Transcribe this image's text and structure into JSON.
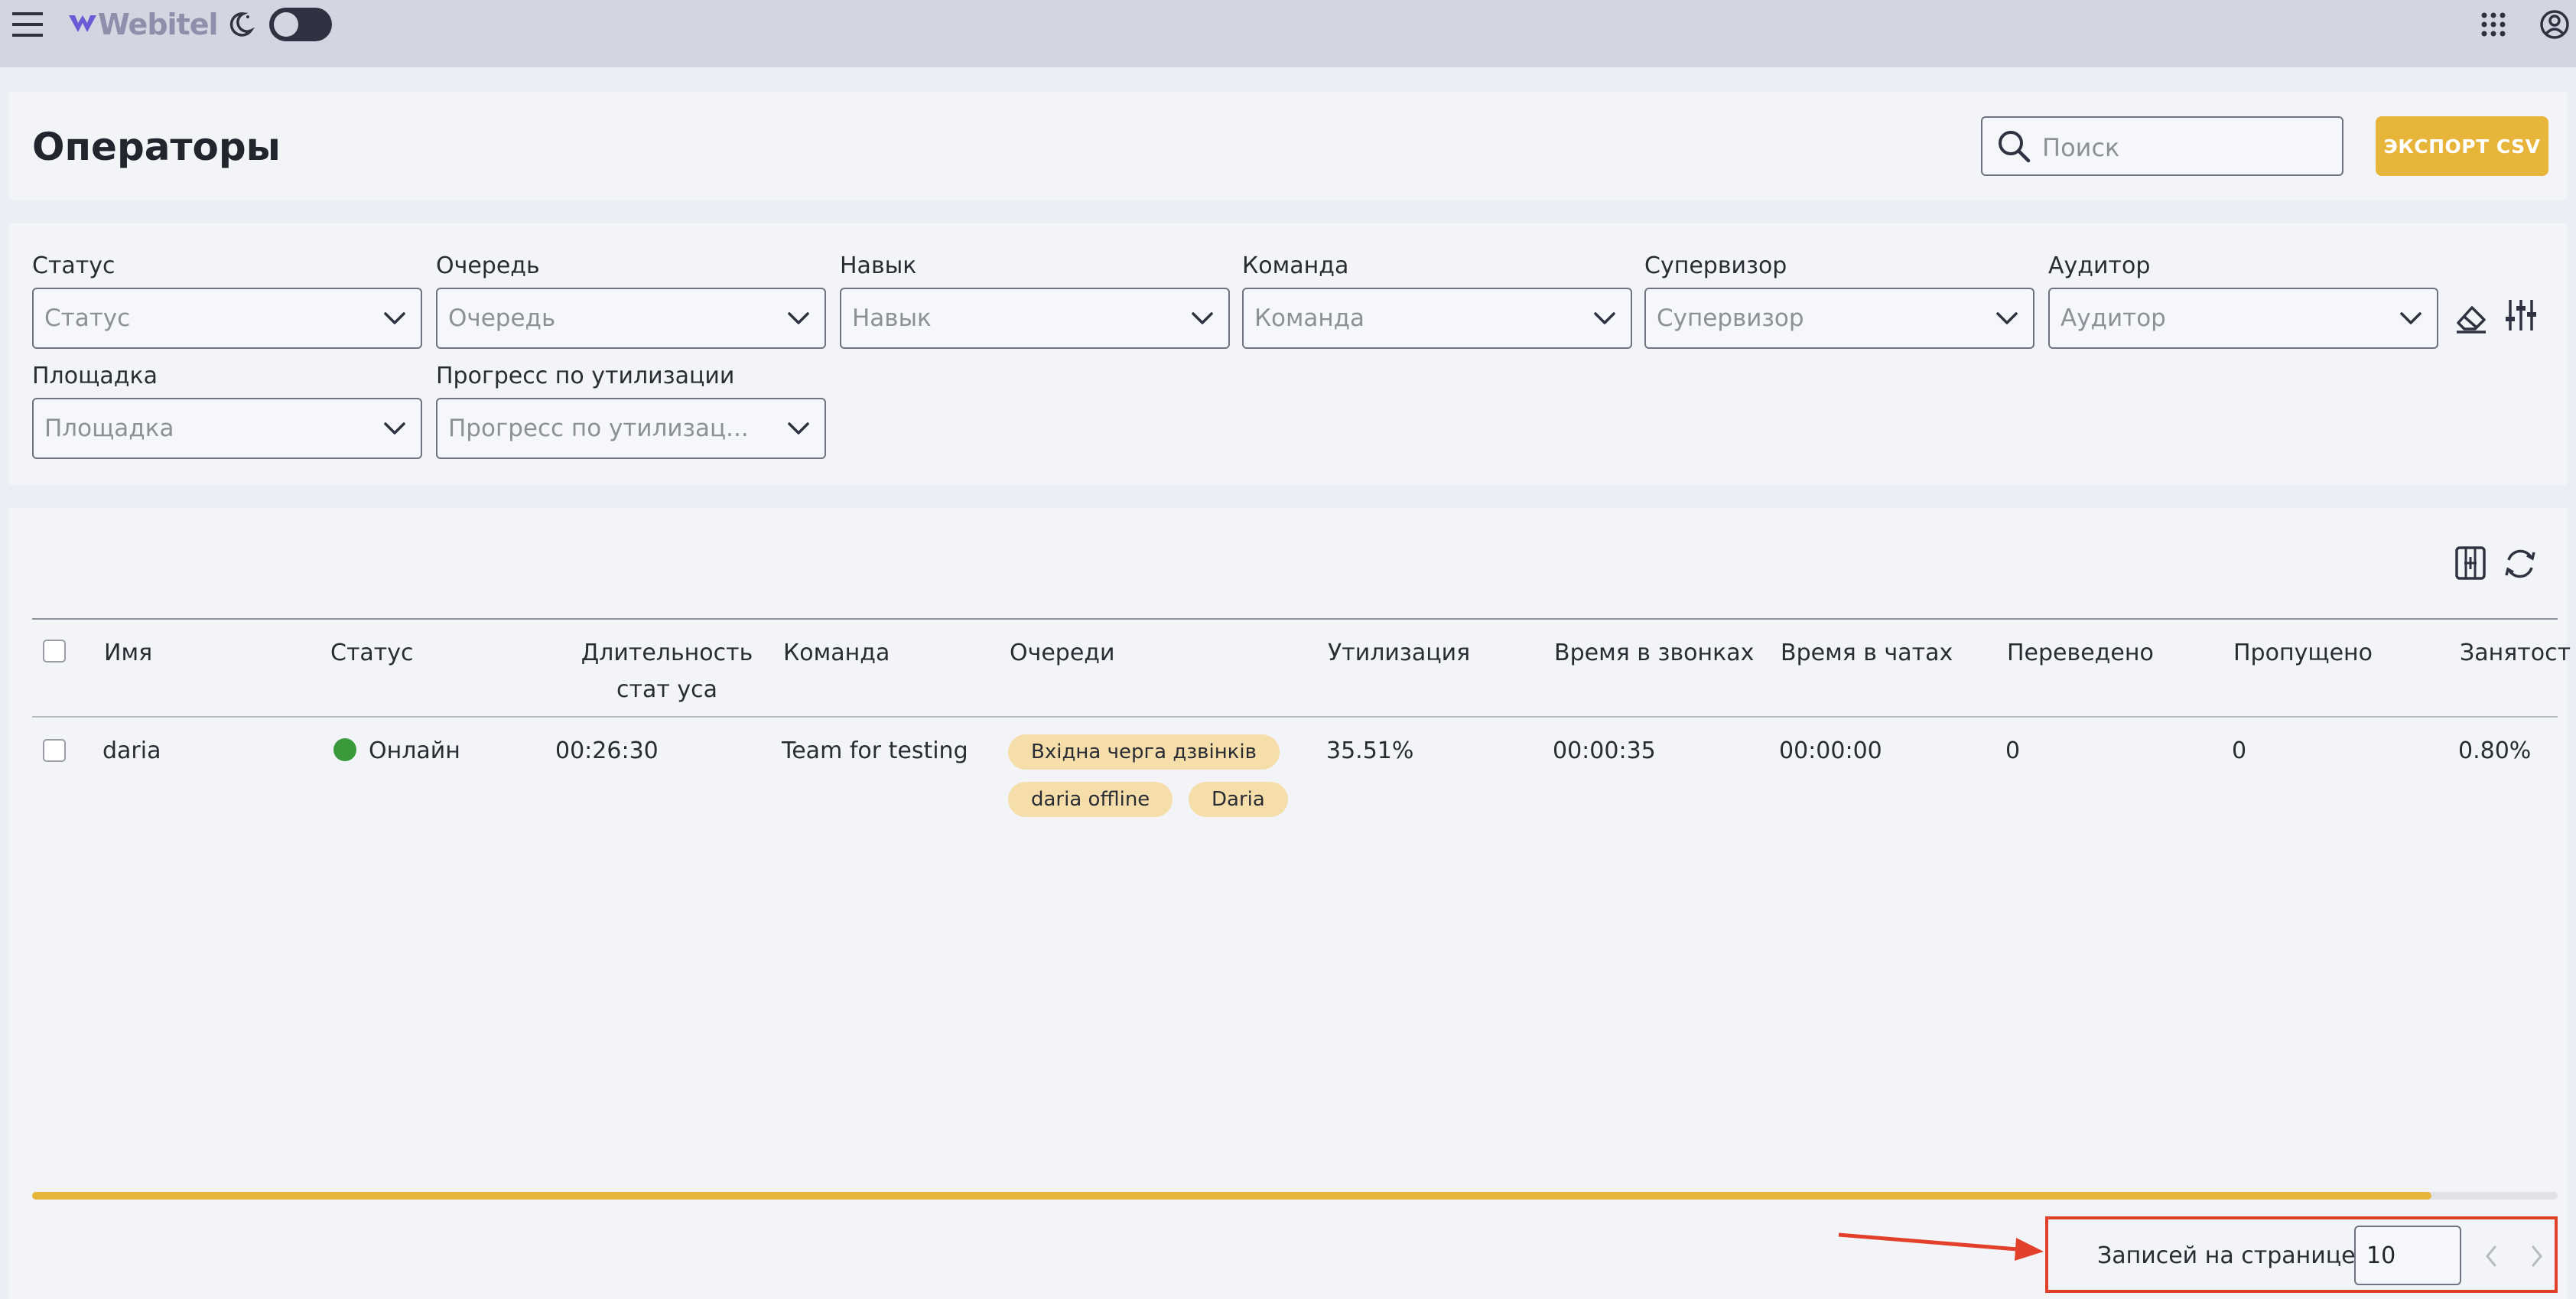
{
  "topbar": {
    "logo_text": "Webitel",
    "icons": [
      "menu-icon",
      "webitel-logo-icon",
      "moon-icon",
      "theme-toggle",
      "apps-grid-icon",
      "user-account-icon"
    ]
  },
  "header": {
    "title": "Операторы",
    "search_placeholder": "Поиск",
    "export_label": "ЭКСПОРТ CSV"
  },
  "filters": {
    "row1": [
      {
        "label": "Статус",
        "placeholder": "Статус"
      },
      {
        "label": "Очередь",
        "placeholder": "Очередь"
      },
      {
        "label": "Навык",
        "placeholder": "Навык"
      },
      {
        "label": "Команда",
        "placeholder": "Команда"
      },
      {
        "label": "Супервизор",
        "placeholder": "Супервизор"
      },
      {
        "label": "Аудитор",
        "placeholder": "Аудитор"
      }
    ],
    "row2": [
      {
        "label": "Площадка",
        "placeholder": "Площадка"
      },
      {
        "label": "Прогресс по утилизации",
        "placeholder": "Прогресс по утилизац..."
      }
    ]
  },
  "table": {
    "columns": [
      "Имя",
      "Статус",
      "Длительность стат уса",
      "Команда",
      "Очереди",
      "Утилизация",
      "Время в звонках",
      "Время в чатах",
      "Переведено",
      "Пропущено",
      "Занятост"
    ],
    "rows": [
      {
        "name": "daria",
        "status": "Онлайн",
        "duration": "00:26:30",
        "team": "Team for testing",
        "queues": [
          "Вхідна черга дзвінків",
          "daria offline",
          "Daria"
        ],
        "utilization": "35.51%",
        "call_time": "00:00:35",
        "chat_time": "00:00:00",
        "transferred": "0",
        "missed": "0",
        "occupancy": "0.80%"
      }
    ],
    "scroll_position_fraction": 0.95
  },
  "colors": {
    "accent": "#e8b53b",
    "online": "#3a9a3b",
    "highlight": "#e3402c",
    "chip": "#f5deaa"
  },
  "pagination": {
    "label": "Записей на странице:",
    "per_page": "10"
  }
}
